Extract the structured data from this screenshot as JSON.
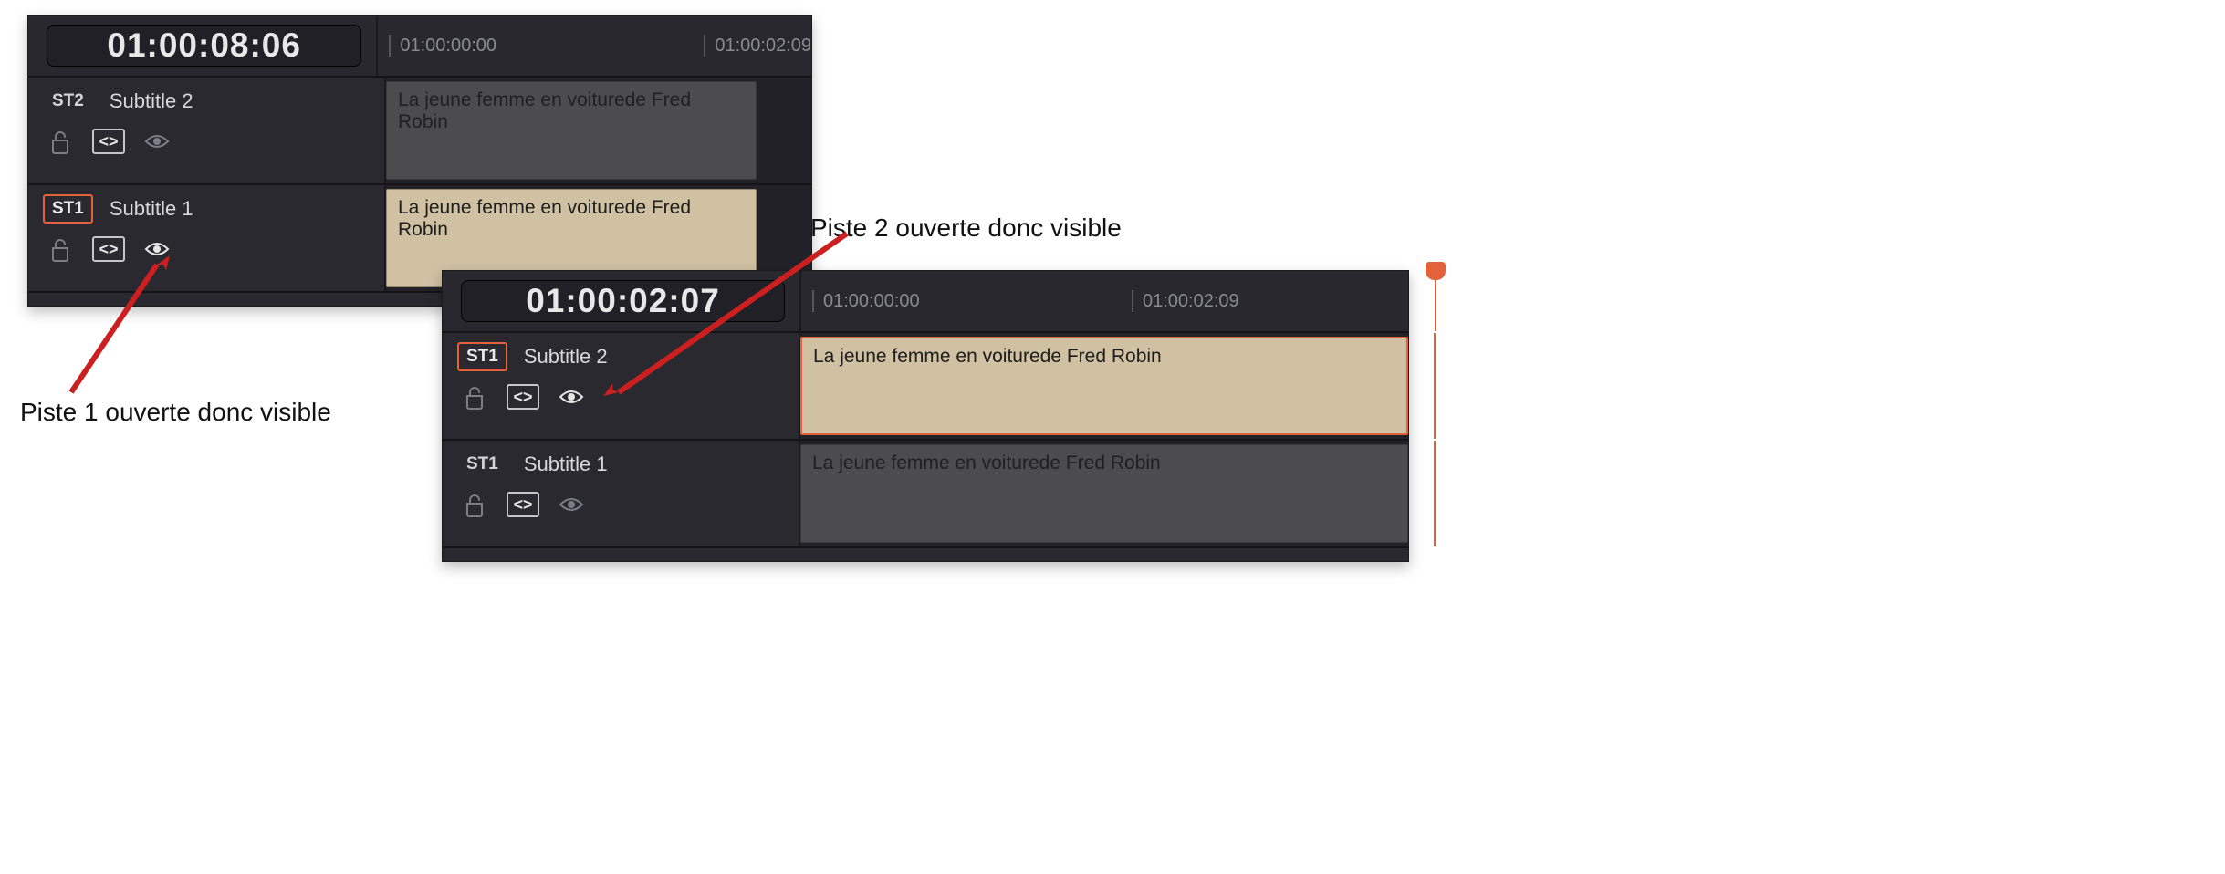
{
  "panel1": {
    "timecode": "01:00:08:06",
    "ruler": [
      "01:00:00:00",
      "01:00:02:09"
    ],
    "tracks": [
      {
        "badge": "ST2",
        "badge_selected": false,
        "name": "Subtitle 2",
        "eye_active": false,
        "clip_text": "La jeune femme en voiturede Fred Robin",
        "clip_state": "dim"
      },
      {
        "badge": "ST1",
        "badge_selected": true,
        "name": "Subtitle 1",
        "eye_active": true,
        "clip_text": "La jeune femme en voiturede Fred Robin",
        "clip_state": "act"
      }
    ]
  },
  "panel2": {
    "timecode": "01:00:02:07",
    "ruler": [
      "01:00:00:00",
      "01:00:02:09"
    ],
    "tracks": [
      {
        "badge": "ST1",
        "badge_selected": true,
        "name": "Subtitle 2",
        "eye_active": true,
        "clip_text": "La jeune femme en voiturede Fred Robin",
        "clip_state": "sel"
      },
      {
        "badge": "ST1",
        "badge_selected": false,
        "name": "Subtitle 1",
        "eye_active": false,
        "clip_text": "La jeune femme en voiturede Fred Robin",
        "clip_state": "dim"
      }
    ]
  },
  "annot": {
    "a1": "Piste 1 ouverte donc visible",
    "a2": "Piste 2 ouverte donc visible"
  },
  "glyph": {
    "code": "<>"
  }
}
